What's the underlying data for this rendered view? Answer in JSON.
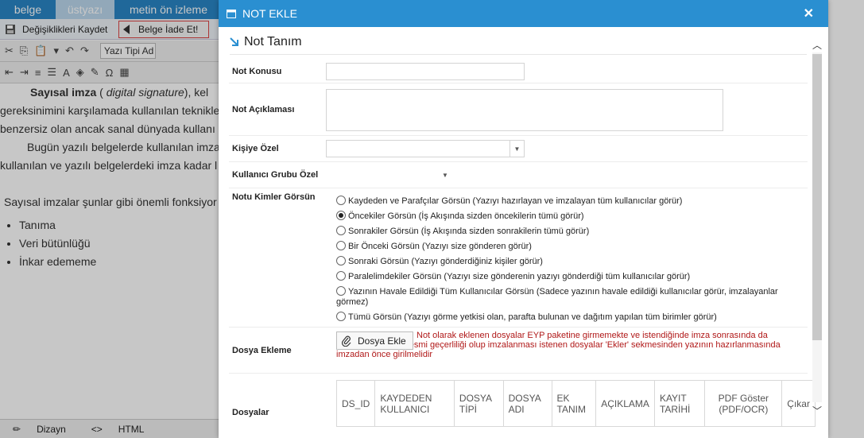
{
  "editor": {
    "tabs": [
      "belge",
      "üstyazı",
      "metin ön izleme"
    ],
    "save_label": "Değişiklikleri Kaydet",
    "return_label": "Belge İade Et!",
    "font_select": "Yazı Tipi Ad",
    "content": {
      "p1_bold": "Sayısal imza",
      "p1_paren": "digital signature",
      "p1_rest": "), kel",
      "p2": "gereksinimini karşılamada kullanılan teknikle",
      "p3": "benzersiz olan ancak sanal dünyada kullanı",
      "p4": "Bugün yazılı belgelerde kullanılan imza",
      "p5": "kullanılan ve yazılı belgelerdeki imza kadar l",
      "p6": "Sayısal imzalar şunlar gibi önemli fonksiyor",
      "bullets": [
        "Tanıma",
        "Veri bütünlüğü",
        "İnkar edememe"
      ]
    },
    "status": {
      "design": "Dizayn",
      "html": "HTML"
    }
  },
  "modal": {
    "title": "NOT EKLE",
    "section": "Not Tanım",
    "fields": {
      "konu": "Not Konusu",
      "aciklama": "Not Açıklaması",
      "kisiye_ozel": "Kişiye Özel",
      "grup_ozel": "Kullanıcı Grubu Özel",
      "kimler": "Notu Kimler Görsün",
      "dosya_ekleme": "Dosya Ekleme",
      "dosyalar": "Dosyalar"
    },
    "radios": [
      {
        "label": "Kaydeden ve Parafçılar Görsün (Yazıyı hazırlayan ve imzalayan tüm kullanıcılar görür)",
        "checked": false
      },
      {
        "label": "Öncekiler Görsün (İş Akışında sizden öncekilerin tümü görür)",
        "checked": true
      },
      {
        "label": "Sonrakiler Görsün (İş Akışında sizden sonrakilerin tümü görür)",
        "checked": false
      },
      {
        "label": "Bir Önceki Görsün (Yazıyı size gönderen görür)",
        "checked": false
      },
      {
        "label": "Sonraki Görsün (Yazıyı gönderdiğiniz kişiler görür)",
        "checked": false
      },
      {
        "label": "Paralelimdekiler Görsün (Yazıyı size gönderenin yazıyı gönderdiği tüm kullanıcılar görür)",
        "checked": false
      },
      {
        "label": "Yazının Havale Edildiği Tüm Kullanıcılar Görsün (Sadece yazının havale edildiği kullanıcılar görür, imzalayanlar görmez)",
        "checked": false
      },
      {
        "label": "Tümü Görsün (Yazıyı görme yetkisi olan, parafta bulunan ve dağıtım yapılan tüm birimler görür)",
        "checked": false
      }
    ],
    "file_button": "Dosya Ekle",
    "file_warning": "Not olarak eklenen dosyalar EYP paketine girmemekte ve istendiğinde imza sonrasında da silinebilmektedir. Resmi geçerliliği olup imzalanması istenen dosyalar 'Ekler' sekmesinden yazının hazırlanmasında imzadan önce girilmelidir",
    "table_headers": [
      "DS_ID",
      "KAYDEDEN KULLANICI",
      "DOSYA TİPİ",
      "DOSYA ADI",
      "EK TANIM",
      "AÇIKLAMA",
      "KAYIT TARİHİ",
      "PDF Göster (PDF/OCR)",
      "Çıkar"
    ]
  },
  "colors": {
    "header": "#2a8fd1",
    "warning": "#b01818"
  }
}
